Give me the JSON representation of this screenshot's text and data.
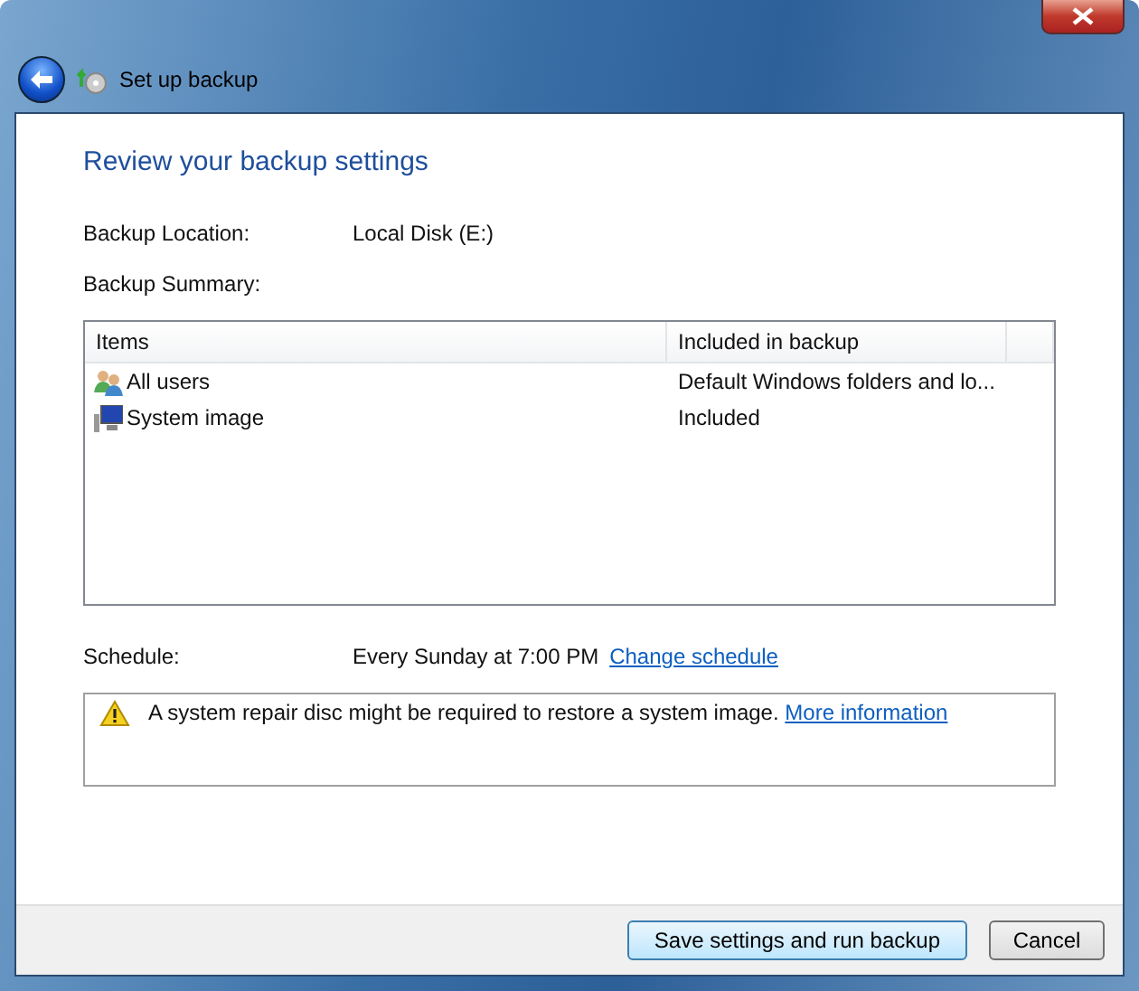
{
  "window": {
    "title": "Set up backup"
  },
  "heading": "Review your backup settings",
  "fields": [
    {
      "label": "Backup Location:",
      "value": "Local Disk (E:)"
    }
  ],
  "summary_label": "Backup Summary:",
  "table": {
    "columns": [
      "Items",
      "Included in backup"
    ],
    "rows": [
      {
        "kind": "users",
        "item": "All users",
        "included": "Default Windows folders and lo..."
      },
      {
        "kind": "image",
        "item": "System image",
        "included": "Included"
      }
    ]
  },
  "schedule": {
    "label": "Schedule:",
    "value": "Every Sunday at 7:00 PM",
    "link": "Change schedule"
  },
  "warning": {
    "text": "A system repair disc might be required to restore a system image.",
    "link": "More information"
  },
  "buttons": [
    {
      "label": "Save settings and run backup",
      "default": true
    },
    {
      "label": "Cancel",
      "default": false
    }
  ]
}
